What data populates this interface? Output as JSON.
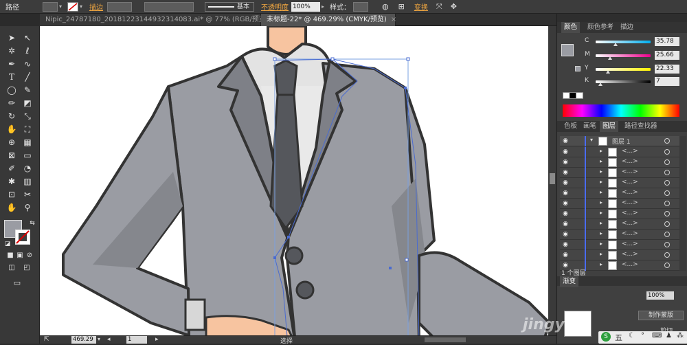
{
  "control_bar": {
    "selection_label": "路径",
    "stroke_label": "描边",
    "stroke_profile": "基本",
    "opacity_label": "不透明度",
    "opacity_value": "100%",
    "style_label": "样式",
    "transform_label": "变换"
  },
  "tabs": [
    {
      "label": "Nipic_24787180_20181223144932314083.ai* @ 77% (RGB/预览)",
      "active": false
    },
    {
      "label": "未标题-22* @ 469.29% (CMYK/预览)",
      "active": true
    }
  ],
  "tab_close_glyph": "×",
  "status_bar": {
    "zoom": "469.29",
    "page": "1",
    "tool_name": "选择"
  },
  "color_panel": {
    "tabs": [
      "颜色",
      "颜色参考",
      "描边"
    ],
    "active_tab": 0,
    "channels": [
      {
        "label": "C",
        "value": "35.78",
        "knob": 0.36,
        "gradient": "linear-gradient(90deg,#ffffff,#00aeef)"
      },
      {
        "label": "M",
        "value": "25.66",
        "knob": 0.26,
        "gradient": "linear-gradient(90deg,#ffffff,#ec008c)"
      },
      {
        "label": "Y",
        "value": "22.33",
        "knob": 0.22,
        "gradient": "linear-gradient(90deg,#ffffff,#fff200)"
      },
      {
        "label": "K",
        "value": "7",
        "knob": 0.07,
        "gradient": "linear-gradient(90deg,#ffffff,#000000)"
      }
    ],
    "fill_color": "#9a9ca3"
  },
  "layers_panel": {
    "tabs": [
      "色板",
      "画笔",
      "图层",
      "路径查找器"
    ],
    "active_tab": 2,
    "layer_name": "图层 1",
    "sublayer_name": "<...>",
    "row_count": 13,
    "footer": "1 个图层"
  },
  "bottom_panel": {
    "tab_label": "渐变",
    "value": "100%",
    "button_label": "制作蒙版",
    "cut_label": "剪切"
  },
  "watermark": "jingyan",
  "taskbar_ime": "五"
}
